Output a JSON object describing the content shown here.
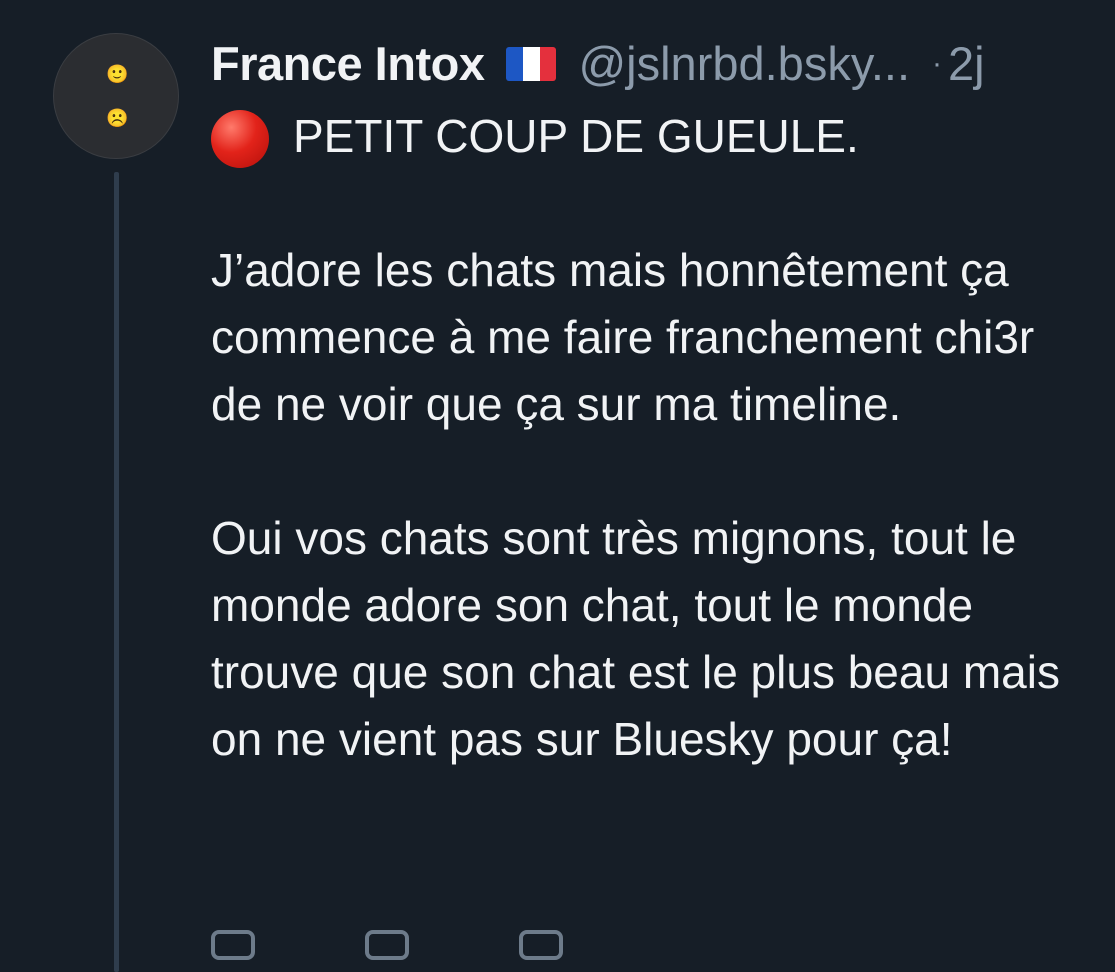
{
  "post": {
    "author": {
      "display_name": "France Intox",
      "flag_icon": "france-flag-icon",
      "handle": "@jslnrbd.bsky...",
      "separator": "·",
      "time": "2j"
    },
    "avatar": {
      "top_emoji": "🙂",
      "bottom_emoji": "☹️"
    },
    "text": {
      "headline_icon": "red-circle-icon",
      "headline": "PETIT COUP DE GUEULE.",
      "paragraph_1": "J’adore les chats mais honnêtement ça commence à me faire franchement chi3r de ne voir que ça sur ma timeline.",
      "paragraph_2": "Oui vos chats sont très mignons, tout le monde adore son chat, tout le monde trouve que son chat est le plus beau mais on ne vient pas sur Bluesky pour ça!"
    }
  },
  "colors": {
    "background": "#161e27",
    "text_primary": "#f1f3f5",
    "text_secondary": "#8c9bab",
    "thread_line": "#2f3d4d"
  }
}
